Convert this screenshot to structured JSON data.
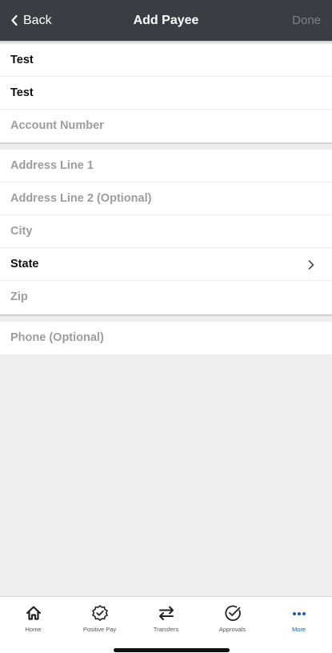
{
  "navbar": {
    "back_label": "Back",
    "title": "Add Payee",
    "done_label": "Done"
  },
  "section1": {
    "name_value": "Test",
    "nickname_value": "Test",
    "account_number_placeholder": "Account Number"
  },
  "section2": {
    "address1_placeholder": "Address Line 1",
    "address2_placeholder": "Address Line 2 (Optional)",
    "city_placeholder": "City",
    "state_label": "State",
    "zip_placeholder": "Zip"
  },
  "section3": {
    "phone_placeholder": "Phone (Optional)"
  },
  "tabbar": {
    "tabs": [
      {
        "label": "Home",
        "icon": "home-icon"
      },
      {
        "label": "Positive Pay",
        "icon": "badge-check-icon"
      },
      {
        "label": "Transfers",
        "icon": "transfer-arrows-icon"
      },
      {
        "label": "Approvals",
        "icon": "check-circle-icon"
      },
      {
        "label": "More",
        "icon": "more-dots-icon"
      }
    ],
    "active_tab": "More",
    "accent_color": "#1e5ea8"
  },
  "colors": {
    "navbar_bg": "#3a3e44",
    "background": "#eeeeee"
  }
}
